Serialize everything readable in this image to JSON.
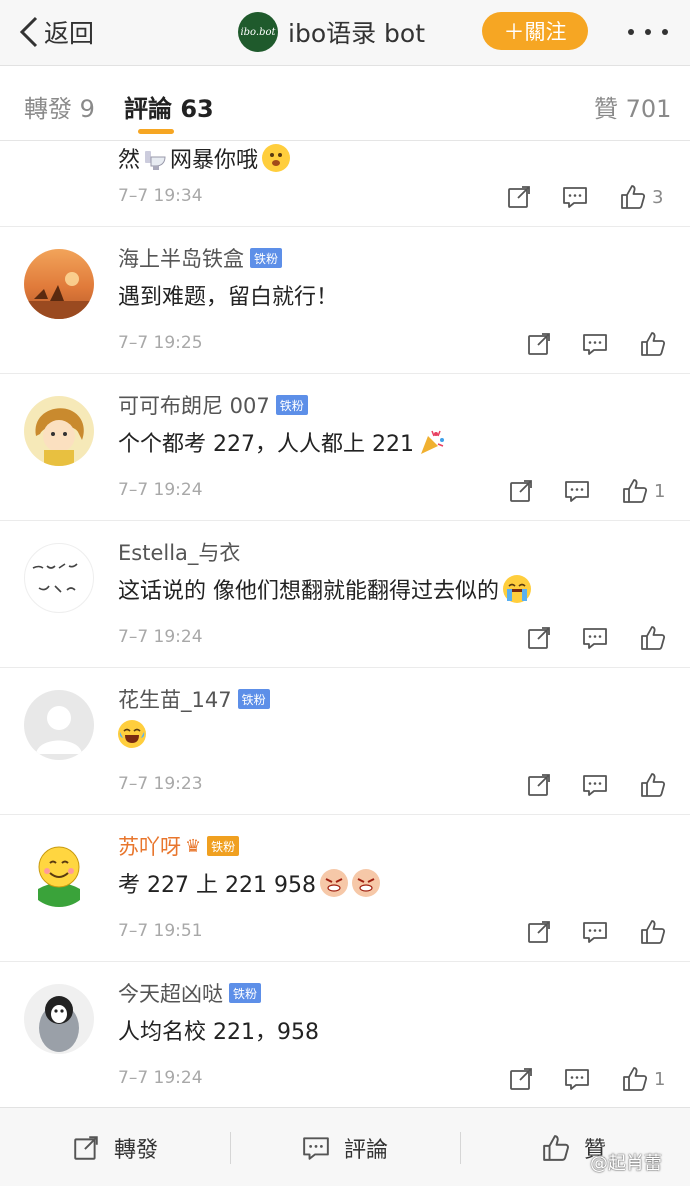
{
  "topbar": {
    "back_label": "返回",
    "account_logo_text": "ibo.bot",
    "account_name": "ibo语录 bot",
    "follow_label": "＋關注"
  },
  "tabs": {
    "repost": "轉發 9",
    "comments": "評論 63",
    "likes": "贊 701"
  },
  "partial_comment": {
    "text_before": "然",
    "text_after": "网暴你哦",
    "time": "7–7 19:34",
    "likes": "3"
  },
  "comments": [
    {
      "name": "海上半岛铁盒",
      "badge": "铁粉",
      "text": "遇到难题，留白就行！",
      "time": "7–7 19:25",
      "likes": ""
    },
    {
      "name": "可可布朗尼 007",
      "badge": "铁粉",
      "text": "个个都考 227，人人都上 221",
      "time": "7–7 19:24",
      "likes": "1"
    },
    {
      "name": "Estella_与衣",
      "badge": "",
      "text": "这话说的 像他们想翻就能翻得过去似的",
      "time": "7–7 19:24",
      "likes": ""
    },
    {
      "name": "花生苗_147",
      "badge": "铁粉",
      "text": "",
      "time": "7–7 19:23",
      "likes": ""
    },
    {
      "name": "苏吖呀",
      "badge": "铁粉",
      "text": "考 227 上 221 958",
      "time": "7–7 19:51",
      "likes": ""
    },
    {
      "name": "今天超凶哒",
      "badge": "铁粉",
      "text": "人均名校 221，958",
      "time": "7–7 19:24",
      "likes": "1"
    }
  ],
  "bottombar": {
    "repost": "轉發",
    "comment": "評論",
    "like": "贊"
  },
  "watermark": "@起肖蕾",
  "colors": {
    "accent": "#f6a623",
    "fan_badge": "#5d8fe8",
    "vip_name": "#e8762d"
  }
}
